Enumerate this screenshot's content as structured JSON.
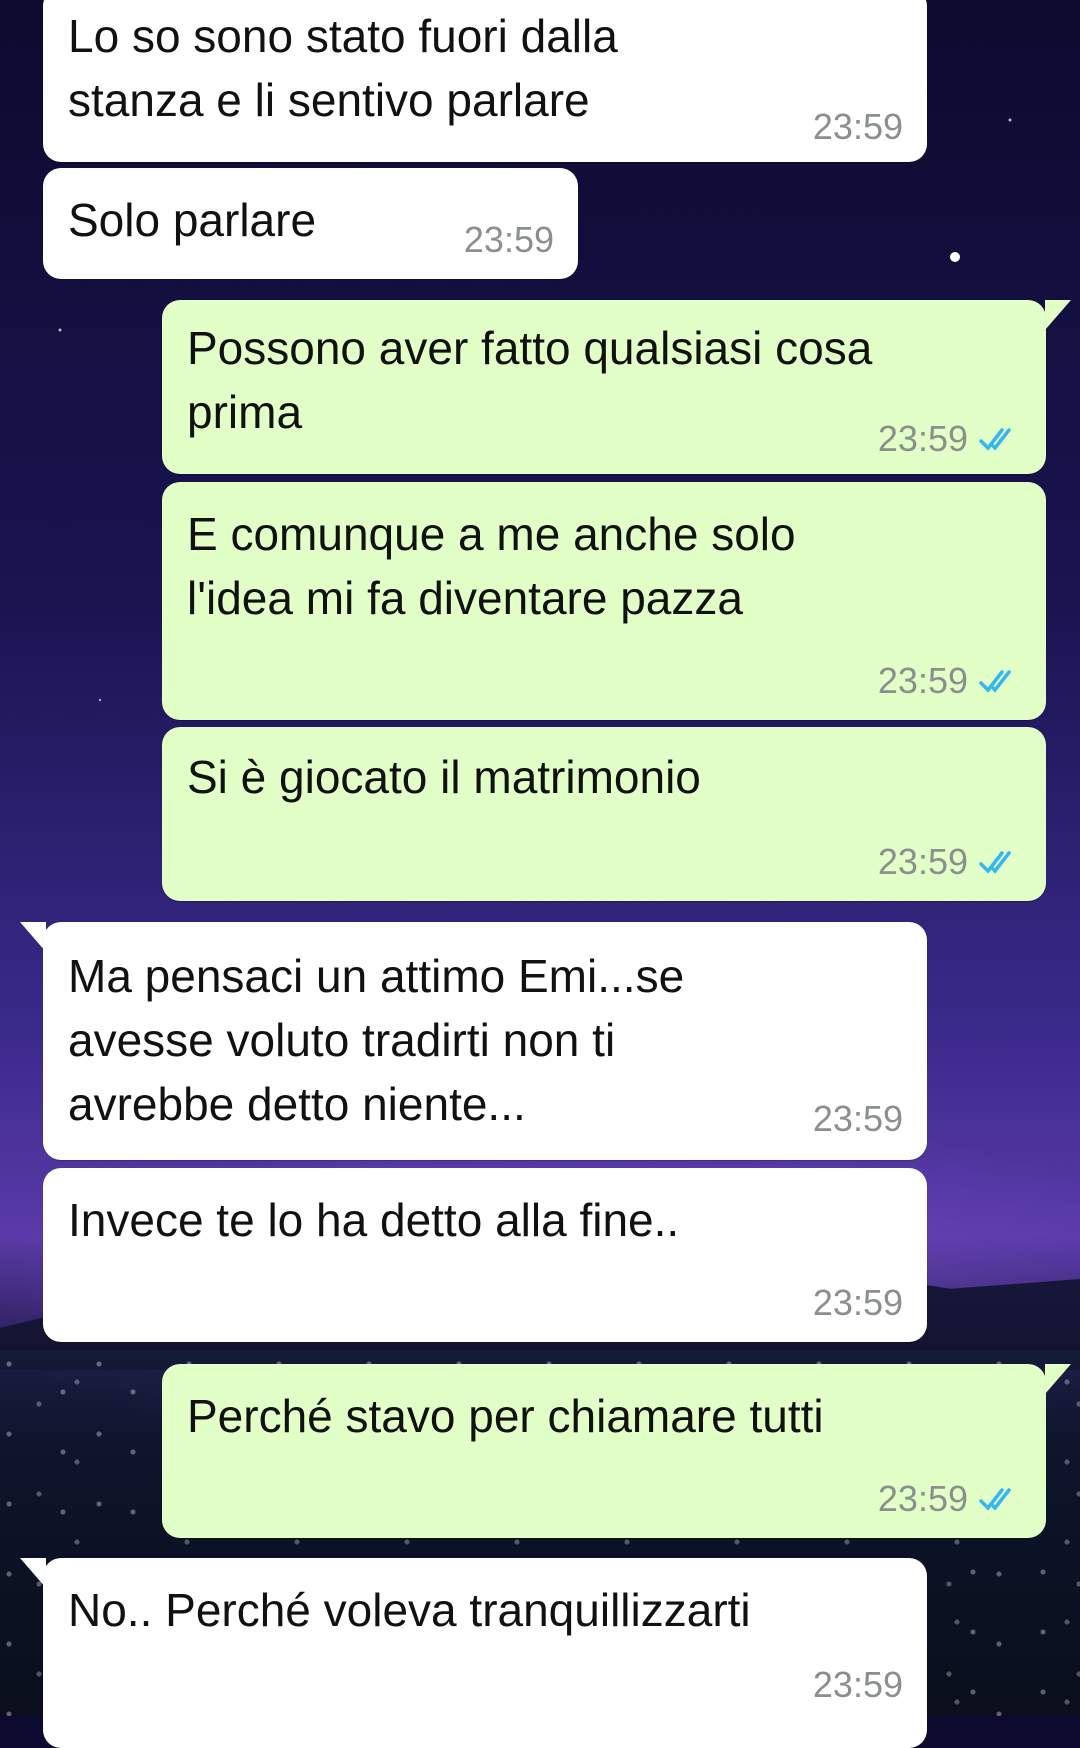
{
  "messages": [
    {
      "dir": "in",
      "text": "Lo so sono stato fuori dalla\nstanza e li sentivo parlare",
      "time": "23:59"
    },
    {
      "dir": "in",
      "text": "Solo parlare",
      "time": "23:59"
    },
    {
      "dir": "out",
      "text": "Possono aver fatto qualsiasi cosa\nprima",
      "time": "23:59",
      "status": "read"
    },
    {
      "dir": "out",
      "text": "E comunque a me anche solo\nl'idea mi fa diventare pazza",
      "time": "23:59",
      "status": "read"
    },
    {
      "dir": "out",
      "text": "Si è giocato il matrimonio",
      "time": "23:59",
      "status": "read"
    },
    {
      "dir": "in",
      "text": "Ma pensaci un attimo Emi...se\navesse voluto tradirti non ti\navrebbe detto niente...",
      "time": "23:59"
    },
    {
      "dir": "in",
      "text": "Invece te lo ha detto alla fine..",
      "time": "23:59"
    },
    {
      "dir": "out",
      "text": "Perché stavo per chiamare tutti",
      "time": "23:59",
      "status": "read"
    },
    {
      "dir": "in",
      "text": "No.. Perché voleva tranquillizzarti",
      "time": "23:59"
    }
  ],
  "colors": {
    "incoming": "#ffffff",
    "outgoing": "#e2ffc7",
    "read_ticks": "#34b7f1",
    "time": "#8b8f8f"
  },
  "icons": {
    "read_receipt": "double-check-icon"
  }
}
